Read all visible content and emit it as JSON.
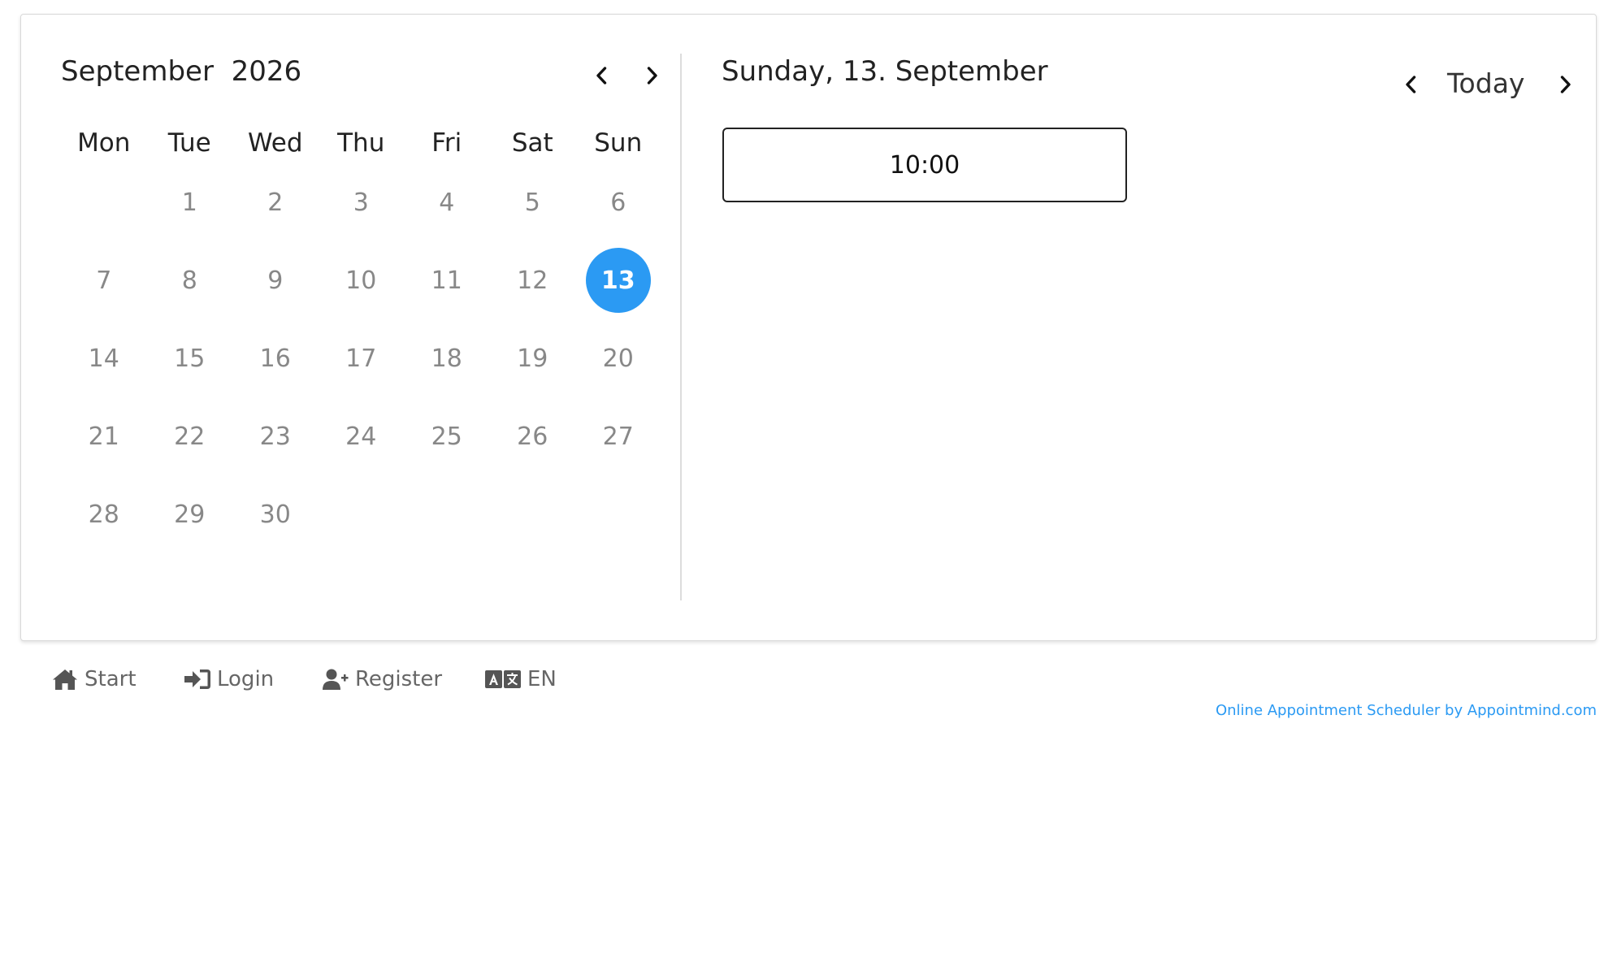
{
  "calendar": {
    "month": "September",
    "year": "2026",
    "weekdays": [
      "Mon",
      "Tue",
      "Wed",
      "Thu",
      "Fri",
      "Sat",
      "Sun"
    ],
    "first_day_offset": 1,
    "days": [
      "1",
      "2",
      "3",
      "4",
      "5",
      "6",
      "7",
      "8",
      "9",
      "10",
      "11",
      "12",
      "13",
      "14",
      "15",
      "16",
      "17",
      "18",
      "19",
      "20",
      "21",
      "22",
      "23",
      "24",
      "25",
      "26",
      "27",
      "28",
      "29",
      "30"
    ],
    "selected_day": "13",
    "selected_color": "#2b9af3"
  },
  "day_view": {
    "title": "Sunday, 13. September",
    "today_label": "Today",
    "slots": [
      "10:00"
    ]
  },
  "footer": {
    "start": "Start",
    "login": "Login",
    "register": "Register",
    "language": "EN",
    "credit": "Online Appointment Scheduler by Appointmind.com"
  },
  "icons": {
    "prev": "chevron-left-icon",
    "next": "chevron-right-icon",
    "start": "home-icon",
    "login": "sign-in-icon",
    "register": "user-plus-icon",
    "language": "language-icon"
  }
}
